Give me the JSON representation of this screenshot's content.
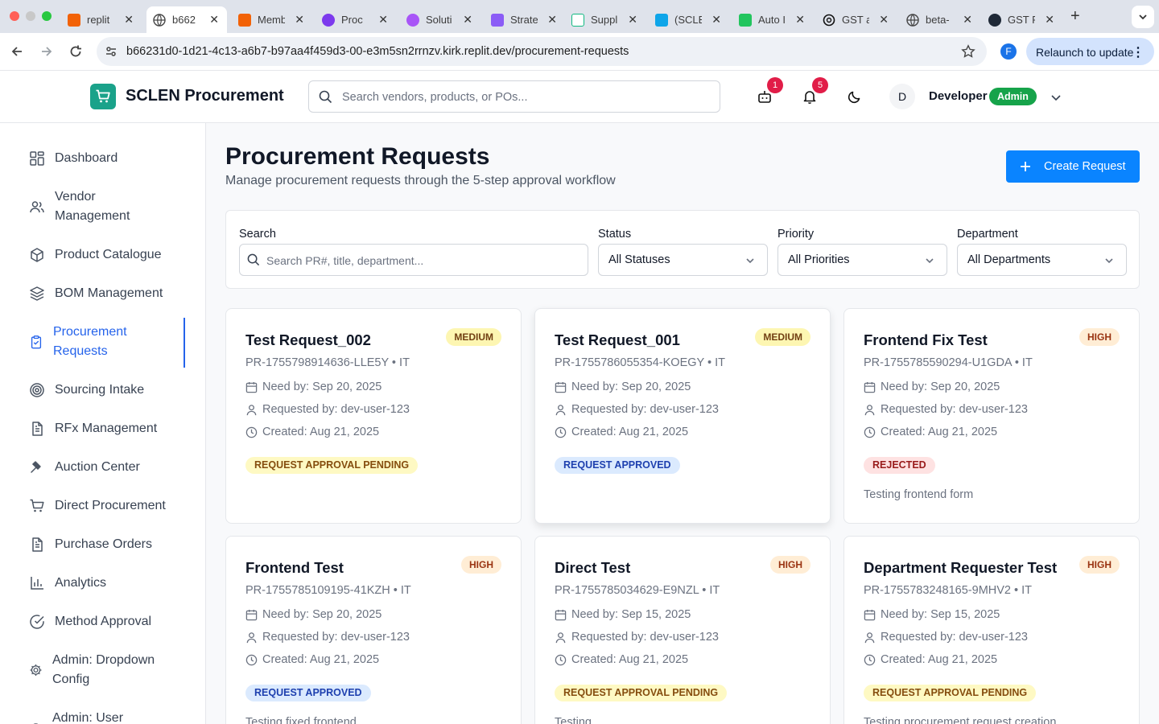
{
  "browser": {
    "tabs": [
      {
        "title": "replit",
        "color": "#f26207"
      },
      {
        "title": "b662",
        "color": "#5f6368"
      },
      {
        "title": "Memb",
        "color": "#f26207"
      },
      {
        "title": "Proc",
        "color": "#7c3aed"
      },
      {
        "title": "Soluti",
        "color": "#a855f7"
      },
      {
        "title": "Strate",
        "color": "#8b5cf6"
      },
      {
        "title": "Suppl",
        "color": "#10b981"
      },
      {
        "title": "(SCLE",
        "color": "#0ea5e9"
      },
      {
        "title": "Auto I",
        "color": "#22c55e"
      },
      {
        "title": "GST a",
        "color": "#111111"
      },
      {
        "title": "beta-",
        "color": "#5f6368"
      },
      {
        "title": "GST F",
        "color": "#1f2937"
      }
    ],
    "url": "b66231d0-1d21-4c13-a6b7-b97aa4f459d3-00-e3m5sn2rrnzv.kirk.replit.dev/procurement-requests",
    "profile_initial": "F",
    "relaunch_label": "Relaunch to update"
  },
  "header": {
    "brand": "SCLEN Procurement",
    "search_placeholder": "Search vendors, products, or POs...",
    "bot_badge": "1",
    "notif_badge": "5",
    "avatar_initial": "D",
    "user_name": "Developer",
    "user_role": "Admin"
  },
  "sidebar": {
    "items": [
      {
        "label": "Dashboard"
      },
      {
        "label": "Vendor Management"
      },
      {
        "label": "Product Catalogue"
      },
      {
        "label": "BOM Management"
      },
      {
        "label": "Procurement Requests"
      },
      {
        "label": "Sourcing Intake"
      },
      {
        "label": "RFx Management"
      },
      {
        "label": "Auction Center"
      },
      {
        "label": "Direct Procurement"
      },
      {
        "label": "Purchase Orders"
      },
      {
        "label": "Analytics"
      },
      {
        "label": "Method Approval"
      },
      {
        "label": "Admin: Dropdown Config"
      },
      {
        "label": "Admin: User"
      }
    ]
  },
  "page": {
    "title": "Procurement Requests",
    "subtitle": "Manage procurement requests through the 5-step approval workflow",
    "create_label": "Create Request"
  },
  "filters": {
    "search_label": "Search",
    "search_placeholder": "Search PR#, title, department...",
    "status_label": "Status",
    "status_value": "All Statuses",
    "priority_label": "Priority",
    "priority_value": "All Priorities",
    "department_label": "Department",
    "department_value": "All Departments"
  },
  "requests": [
    {
      "title": "Test Request_002",
      "priority": "MEDIUM",
      "pr": "PR-1755798914636-LLE5Y • IT",
      "need_by": "Need by: Sep 20, 2025",
      "requested_by": "Requested by: dev-user-123",
      "created": "Created: Aug 21, 2025",
      "status": "REQUEST APPROVAL PENDING",
      "description": ""
    },
    {
      "title": "Test Request_001",
      "priority": "MEDIUM",
      "pr": "PR-1755786055354-KOEGY • IT",
      "need_by": "Need by: Sep 20, 2025",
      "requested_by": "Requested by: dev-user-123",
      "created": "Created: Aug 21, 2025",
      "status": "REQUEST APPROVED",
      "description": ""
    },
    {
      "title": "Frontend Fix Test",
      "priority": "HIGH",
      "pr": "PR-1755785590294-U1GDA • IT",
      "need_by": "Need by: Sep 20, 2025",
      "requested_by": "Requested by: dev-user-123",
      "created": "Created: Aug 21, 2025",
      "status": "REJECTED",
      "description": "Testing frontend form"
    },
    {
      "title": "Frontend Test",
      "priority": "HIGH",
      "pr": "PR-1755785109195-41KZH • IT",
      "need_by": "Need by: Sep 20, 2025",
      "requested_by": "Requested by: dev-user-123",
      "created": "Created: Aug 21, 2025",
      "status": "REQUEST APPROVED",
      "description": "Testing fixed frontend"
    },
    {
      "title": "Direct Test",
      "priority": "HIGH",
      "pr": "PR-1755785034629-E9NZL • IT",
      "need_by": "Need by: Sep 15, 2025",
      "requested_by": "Requested by: dev-user-123",
      "created": "Created: Aug 21, 2025",
      "status": "REQUEST APPROVAL PENDING",
      "description": "Testing"
    },
    {
      "title": "Department Requester Test",
      "priority": "HIGH",
      "pr": "PR-1755783248165-9MHV2 • IT",
      "need_by": "Need by: Sep 15, 2025",
      "requested_by": "Requested by: dev-user-123",
      "created": "Created: Aug 21, 2025",
      "status": "REQUEST APPROVAL PENDING",
      "description": "Testing procurement request creation"
    }
  ]
}
